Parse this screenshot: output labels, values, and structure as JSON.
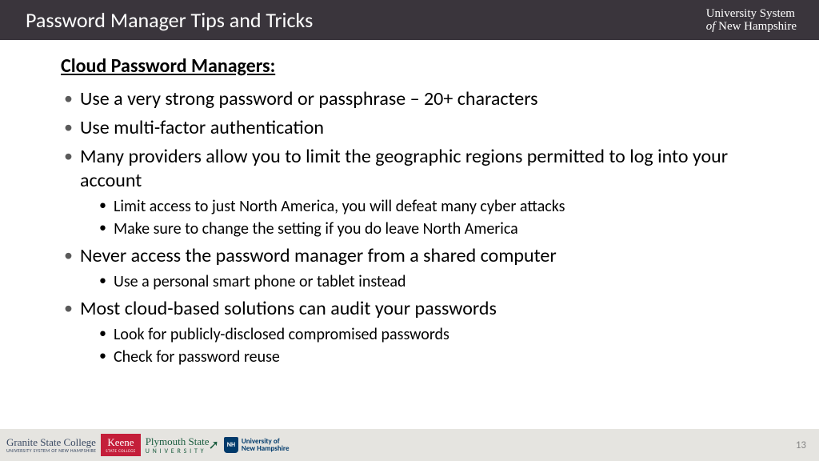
{
  "header": {
    "title": "Password Manager Tips and Tricks",
    "logo_line1": "University System",
    "logo_line2_prefix": "of ",
    "logo_line2_main": "New Hampshire"
  },
  "content": {
    "heading": "Cloud Password Managers:",
    "bullets": [
      {
        "text": "Use a very strong password or passphrase – 20+ characters",
        "sub": []
      },
      {
        "text": "Use multi-factor authentication",
        "sub": []
      },
      {
        "text": "Many providers allow you to limit the geographic regions permitted to log into your account",
        "sub": [
          "Limit access to just North America, you will defeat many cyber attacks",
          "Make sure to change the setting if you do leave North America"
        ]
      },
      {
        "text": "Never access the password manager from a shared computer",
        "sub": [
          "Use a personal smart phone or tablet instead"
        ]
      },
      {
        "text": "Most cloud-based solutions can audit your passwords",
        "sub": [
          "Look for publicly-disclosed compromised passwords",
          "Check for password reuse"
        ]
      }
    ]
  },
  "footer": {
    "gsc_top": "Granite State College",
    "gsc_bottom": "UNIVERSITY SYSTEM OF NEW HAMPSHIRE",
    "keene_top": "Keene",
    "keene_bottom": "STATE COLLEGE",
    "plymouth_top": "Plymouth State",
    "plymouth_bottom": "U N I V E R S I T Y",
    "unh_shield": "NH",
    "unh_line1": "University of",
    "unh_line2": "New Hampshire",
    "page_number": "13"
  }
}
